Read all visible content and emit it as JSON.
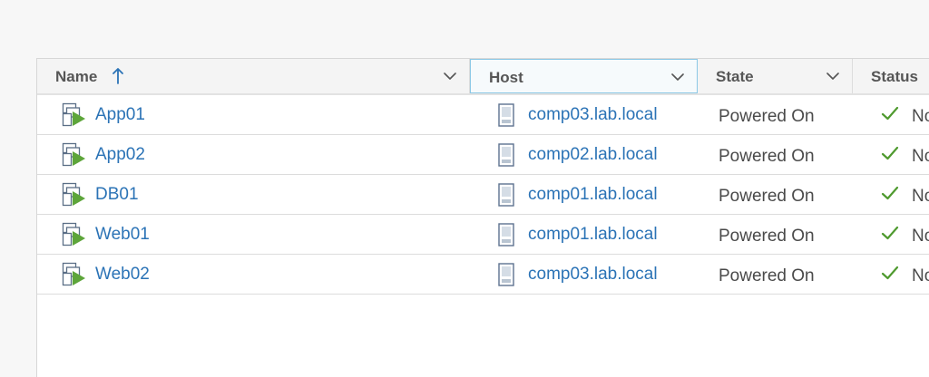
{
  "columns": {
    "name": "Name",
    "host": "Host",
    "state": "State",
    "status": "Status"
  },
  "icons": {
    "sort": "arrow-up-icon",
    "column_menu": "chevron-down-icon",
    "vm": "vm-icon",
    "host": "host-icon",
    "status_ok": "check-icon"
  },
  "colors": {
    "link": "#2b73b6",
    "vm_play": "#5da53a",
    "check": "#4f9a2f",
    "active_header_border": "#8cc8e6"
  },
  "rows": [
    {
      "name": "App01",
      "host": "comp03.lab.local",
      "state": "Powered On",
      "status": "No"
    },
    {
      "name": "App02",
      "host": "comp02.lab.local",
      "state": "Powered On",
      "status": "No"
    },
    {
      "name": "DB01",
      "host": "comp01.lab.local",
      "state": "Powered On",
      "status": "No"
    },
    {
      "name": "Web01",
      "host": "comp01.lab.local",
      "state": "Powered On",
      "status": "No"
    },
    {
      "name": "Web02",
      "host": "comp03.lab.local",
      "state": "Powered On",
      "status": "No"
    }
  ]
}
